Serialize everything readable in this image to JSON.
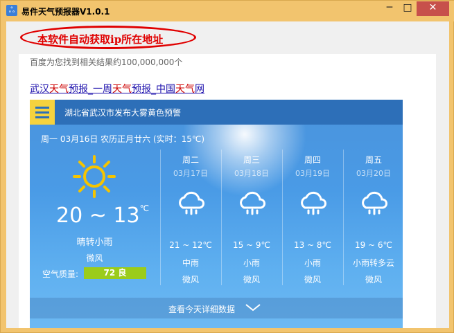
{
  "window": {
    "title": "易件天气预报器V1.0.1",
    "min": "─",
    "max": "□",
    "close": "✕"
  },
  "notice": "本软件自动获取ip所在地址",
  "search": {
    "result_count": "百度为您找到相关结果约100,000,000个",
    "link_parts": [
      "武汉",
      "天气",
      "预报_一周",
      "天气",
      "预报_中国",
      "天气",
      "网"
    ]
  },
  "weather": {
    "warning": "湖北省武汉市发布大雾黄色预警",
    "today_line": "周一 03月16日 农历正月廿六 (实时：15℃)",
    "today_temp": "20 ~ 13",
    "today_temp_unit": "℃",
    "today_cond": "晴转小雨",
    "today_wind": "微风",
    "aqi_label": "空气质量:",
    "aqi_value": "72 良",
    "days": [
      {
        "name": "周二",
        "date": "03月17日",
        "temp": "21 ~ 12℃",
        "cond": "中雨",
        "wind": "微风",
        "icon": "rain-cloud-icon"
      },
      {
        "name": "周三",
        "date": "03月18日",
        "temp": "15 ~ 9℃",
        "cond": "小雨",
        "wind": "微风",
        "icon": "rain-cloud-icon"
      },
      {
        "name": "周四",
        "date": "03月19日",
        "temp": "13 ~ 8℃",
        "cond": "小雨",
        "wind": "微风",
        "icon": "rain-cloud-icon"
      },
      {
        "name": "周五",
        "date": "03月20日",
        "temp": "19 ~ 6℃",
        "cond": "小雨转多云",
        "wind": "微风",
        "icon": "rain-cloud-icon"
      }
    ],
    "more_text": "查看今天详细数据"
  },
  "colors": {
    "accent_red": "#e00000",
    "card_blue": "#4a9be6",
    "header_blue": "#2d6fb8",
    "menu_yellow": "#f5d23e",
    "aqi_green": "#9bcc1a",
    "titlebar": "#f2c46e"
  }
}
